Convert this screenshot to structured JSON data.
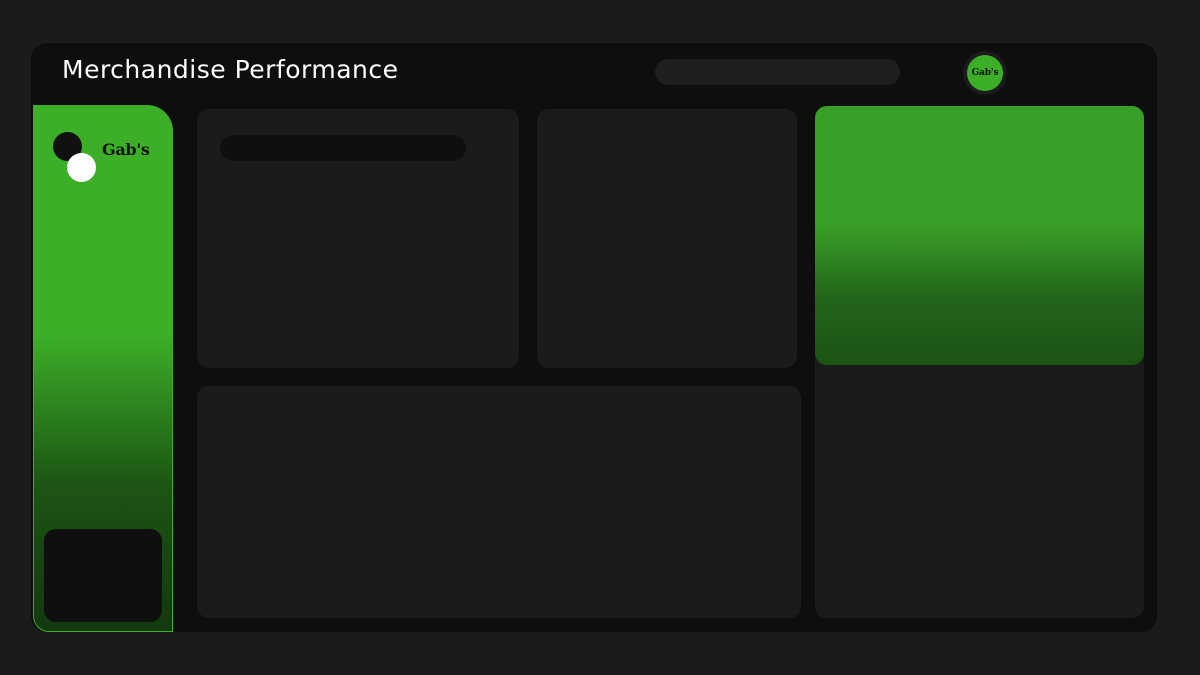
{
  "header": {
    "title": "Merchandise Performance",
    "avatar_label": "Gab's"
  },
  "sidebar": {
    "logo_text": "Gab's"
  },
  "colors": {
    "accent": "#3cae28",
    "background": "#1b1b1b",
    "frame": "#0e0e0e",
    "card": "#1b1b1b"
  }
}
